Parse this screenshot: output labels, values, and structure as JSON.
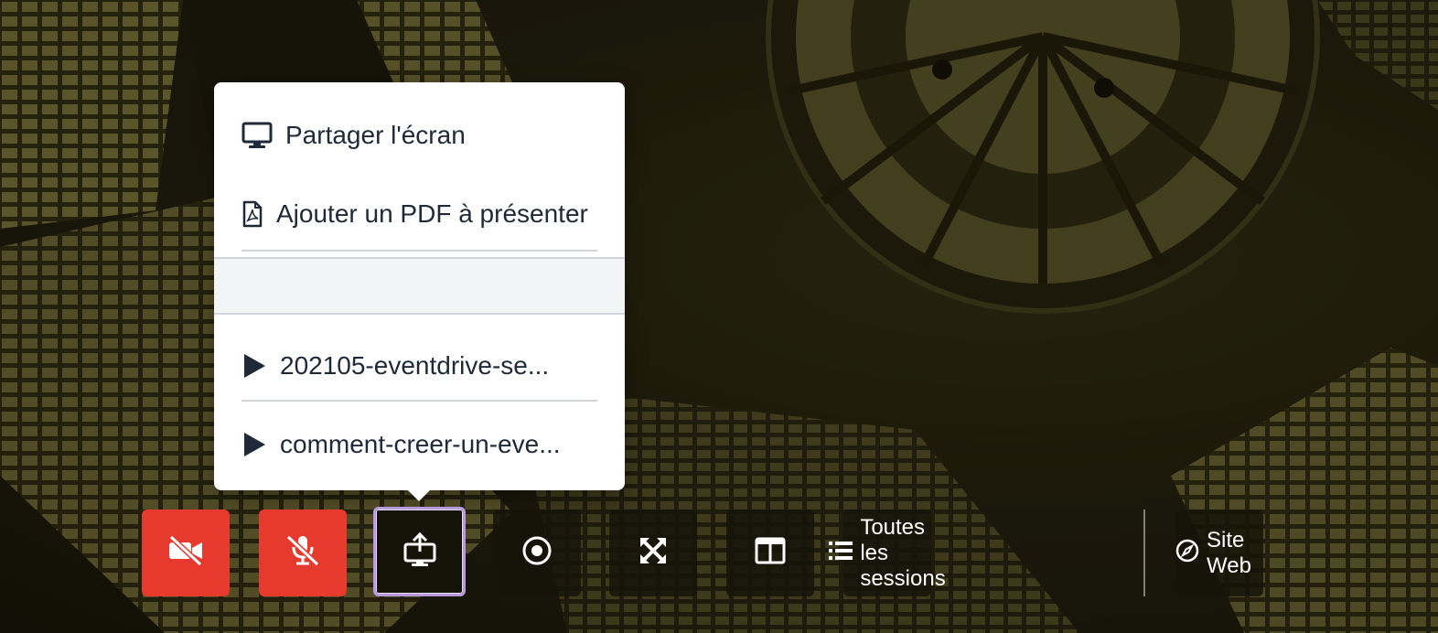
{
  "share_menu": {
    "items": [
      {
        "label": "Partager l'écran",
        "icon": "monitor-icon"
      },
      {
        "label": "Ajouter un PDF à présenter",
        "icon": "file-pdf-icon"
      },
      {
        "label": "202105-eventdrive-se...",
        "icon": "play-icon"
      },
      {
        "label": "comment-creer-un-eve...",
        "icon": "play-icon"
      }
    ]
  },
  "controls": {
    "camera": {
      "icon": "video-off-icon",
      "state": "off",
      "color": "#e63a2e"
    },
    "microphone": {
      "icon": "mic-off-icon",
      "state": "off",
      "color": "#e63a2e"
    },
    "share": {
      "icon": "share-screen-icon",
      "state": "active"
    },
    "record": {
      "icon": "record-icon"
    },
    "fullscreen": {
      "icon": "expand-icon"
    },
    "layout": {
      "icon": "columns-icon"
    },
    "sessions": {
      "label": "Toutes les sessions",
      "icon": "list-icon"
    },
    "website": {
      "label": "Site Web",
      "icon": "compass-icon"
    }
  },
  "colors": {
    "accent_red": "#e63a2e",
    "active_outline": "#b79ad9",
    "popover_bg": "#ffffff",
    "text_dark": "#1f2937"
  }
}
